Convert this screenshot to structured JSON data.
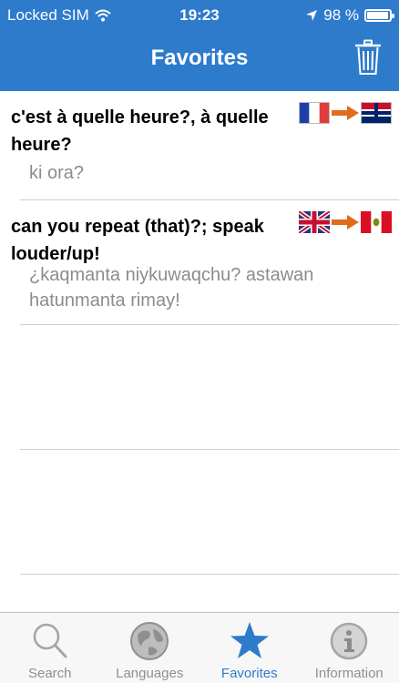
{
  "status_bar": {
    "carrier": "Locked SIM",
    "time": "19:23",
    "battery": "98 %"
  },
  "nav": {
    "title": "Favorites",
    "trash_icon": "trash-icon"
  },
  "favorites": [
    {
      "source": "c'est à quelle heure?, à quelle heure?",
      "translation": "ki ora?",
      "from_flag": "france-flag",
      "to_flag": "new-zealand-maori-flag"
    },
    {
      "source": "can you repeat (that)?; speak louder/up!",
      "translation": "¿kaqmanta niykuwaqchu? astawan hatunmanta rimay!",
      "from_flag": "uk-flag",
      "to_flag": "peru-flag"
    }
  ],
  "tabs": [
    {
      "label": "Search",
      "icon": "magnifier-icon",
      "active": false
    },
    {
      "label": "Languages",
      "icon": "globe-icon",
      "active": false
    },
    {
      "label": "Favorites",
      "icon": "star-icon",
      "active": true
    },
    {
      "label": "Information",
      "icon": "info-icon",
      "active": false
    }
  ],
  "colors": {
    "accent": "#2e7bcc",
    "translation_text": "#8c8c8c",
    "arrow": "#e06a1e"
  }
}
